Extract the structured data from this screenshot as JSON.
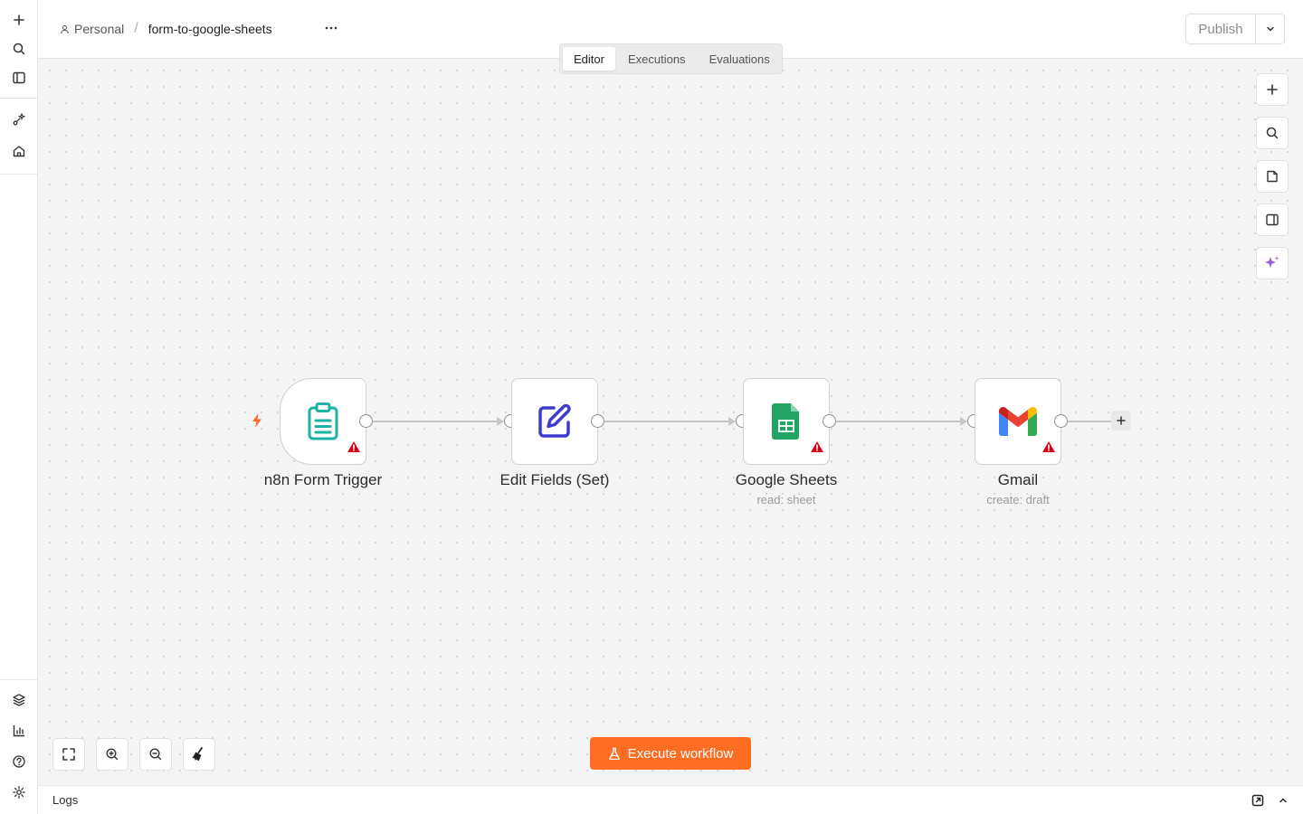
{
  "header": {
    "project_label": "Personal",
    "separator": "/",
    "workflow_name": "form-to-google-sheets",
    "publish_label": "Publish"
  },
  "tabs": [
    {
      "label": "Editor",
      "active": true
    },
    {
      "label": "Executions",
      "active": false
    },
    {
      "label": "Evaluations",
      "active": false
    }
  ],
  "nodes": [
    {
      "label": "n8n Form Trigger",
      "subtitle": "",
      "icon": "clipboard-icon",
      "warning": true
    },
    {
      "label": "Edit Fields (Set)",
      "subtitle": "",
      "icon": "pen-square-icon",
      "warning": false
    },
    {
      "label": "Google Sheets",
      "subtitle": "read: sheet",
      "icon": "google-sheets-icon",
      "warning": true
    },
    {
      "label": "Gmail",
      "subtitle": "create: draft",
      "icon": "gmail-icon",
      "warning": true
    }
  ],
  "execute_label": "Execute workflow",
  "logs_label": "Logs",
  "colors": {
    "accent": "#ff6d23",
    "warning": "#d0021b",
    "trigger": "#ff6d23",
    "form_icon": "#1bb3a4",
    "set_icon": "#3b3bd1",
    "sheets": "#21a464",
    "ai": "#9b59e8"
  }
}
